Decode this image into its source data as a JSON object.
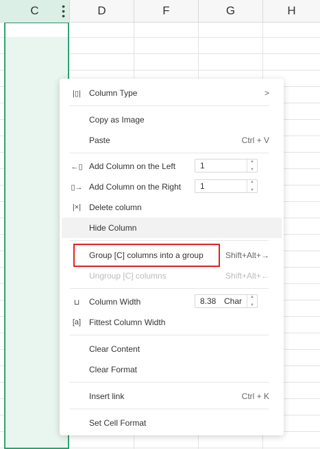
{
  "columns": [
    "C",
    "D",
    "F",
    "G",
    "H"
  ],
  "menu": {
    "column_type": {
      "label": "Column Type",
      "arrow": ">"
    },
    "copy_as_image": {
      "label": "Copy as Image"
    },
    "paste": {
      "label": "Paste",
      "shortcut": "Ctrl + V"
    },
    "add_left": {
      "label": "Add Column on the Left",
      "value": "1"
    },
    "add_right": {
      "label": "Add Column on the Right",
      "value": "1"
    },
    "delete_column": {
      "label": "Delete column"
    },
    "hide_column": {
      "label": "Hide Column"
    },
    "group": {
      "label": "Group [C] columns into a group",
      "shortcut": "Shift+Alt+→"
    },
    "ungroup": {
      "label": "Ungroup [C] columns",
      "shortcut": "Shift+Alt+←"
    },
    "column_width": {
      "label": "Column Width",
      "value": "8.38",
      "unit": "Char"
    },
    "fittest_width": {
      "label": "Fittest Column Width"
    },
    "clear_content": {
      "label": "Clear Content"
    },
    "clear_format": {
      "label": "Clear Format"
    },
    "insert_link": {
      "label": "Insert link",
      "shortcut": "Ctrl + K"
    },
    "set_cell_format": {
      "label": "Set Cell Format"
    }
  },
  "colors": {
    "selection_border": "#2da36f",
    "selection_fill": "#e8f6ef",
    "highlight": "#e02020"
  }
}
